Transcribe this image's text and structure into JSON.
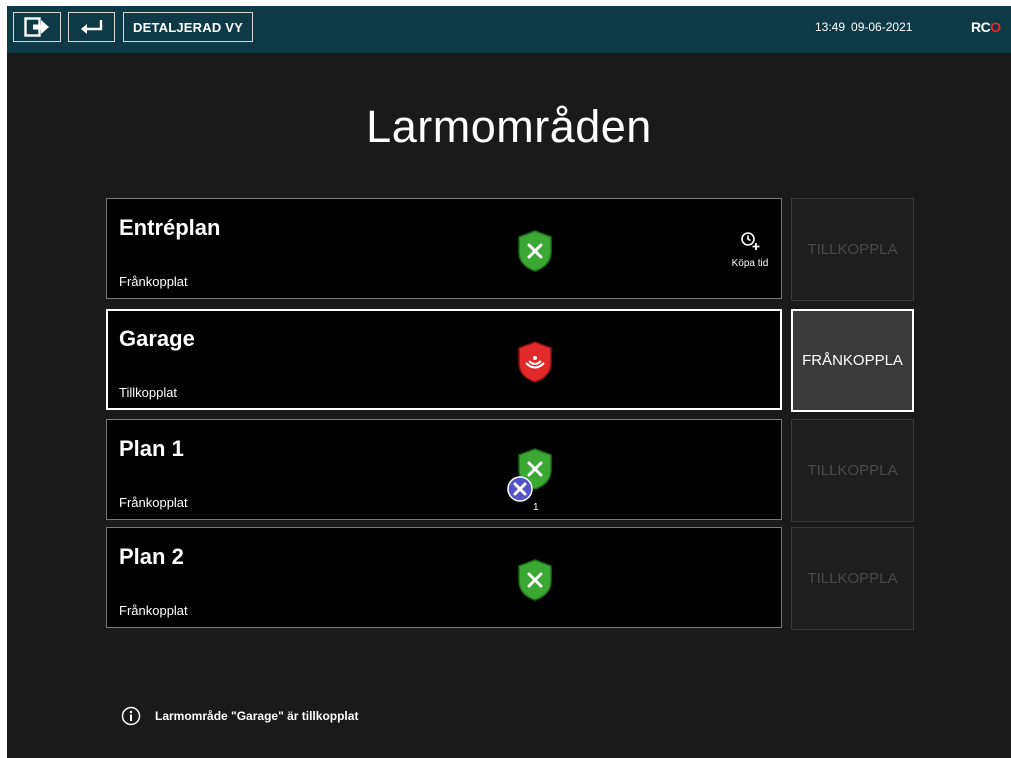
{
  "topbar": {
    "logout_icon": "logout-icon",
    "back_icon": "return-arrow-icon",
    "detail_view_label": "DETALJERAD VY",
    "time": "13:49",
    "date": "09-06-2021",
    "logo": {
      "r": "R",
      "c": "C",
      "o": "O"
    }
  },
  "page": {
    "title": "Larmområden"
  },
  "areas": [
    {
      "name": "Entréplan",
      "status": "Frånkopplat",
      "shield": "shield-check-icon",
      "color": "#3aa832",
      "buy_time_label": "Köpa tid",
      "action_label": "TILLKOPPLA",
      "action_enabled": false
    },
    {
      "name": "Garage",
      "status": "Tillkopplat",
      "shield": "shield-armed-icon",
      "color": "#e32a2a",
      "action_label": "FRÅNKOPPLA",
      "action_enabled": true
    },
    {
      "name": "Plan 1",
      "status": "Frånkopplat",
      "shield": "shield-check-icon",
      "color": "#3aa832",
      "fault_count": "1",
      "action_label": "TILLKOPPLA",
      "action_enabled": false
    },
    {
      "name": "Plan 2",
      "status": "Frånkopplat",
      "shield": "shield-check-icon",
      "color": "#3aa832",
      "action_label": "TILLKOPPLA",
      "action_enabled": false
    }
  ],
  "info_message": "Larmområde \"Garage\" är tillkopplat",
  "colors": {
    "topbar": "#0e3a47",
    "background": "#1a1a1a",
    "shield_green": "#3aa832",
    "shield_red": "#e32a2a",
    "fault_badge": "#5552c8"
  }
}
